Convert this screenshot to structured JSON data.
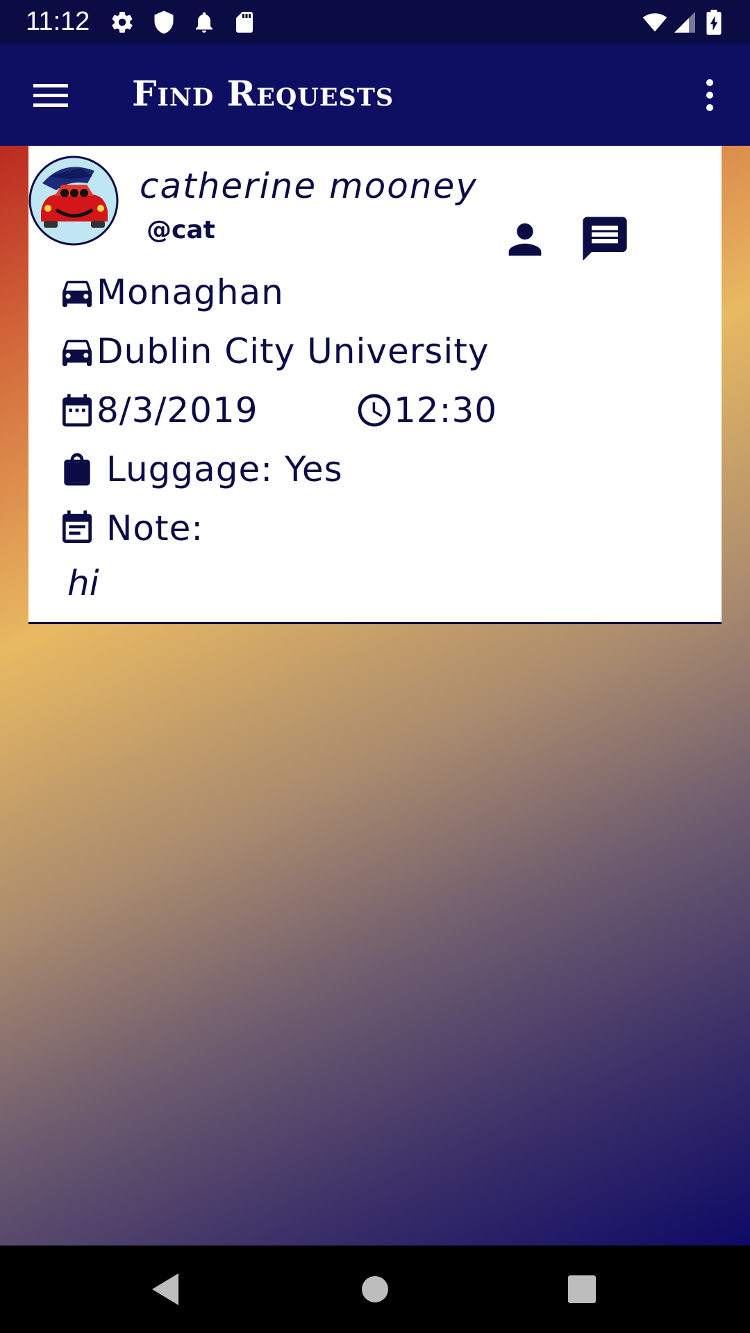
{
  "status_bar": {
    "time": "11:12",
    "icons": [
      "settings-icon",
      "shield-icon",
      "bell-icon",
      "sd-card-icon",
      "wifi-icon",
      "signal-icon",
      "battery-charging-icon"
    ]
  },
  "app_bar": {
    "title": "Find Requests",
    "menu_icon": "hamburger-menu-icon",
    "overflow_icon": "more-vert-icon"
  },
  "request_card": {
    "user_name": "catherine mooney",
    "user_handle": "@cat",
    "from": "Monaghan",
    "to": "Dublin City University",
    "date": "8/3/2019",
    "time": "12:30",
    "luggage": "Luggage: Yes",
    "note_label": "Note:",
    "note": "hi"
  },
  "colors": {
    "primary_dark": "#0c0c45",
    "app_bar": "#0e0f63",
    "card": "#ffffff",
    "text": "#0c0c45"
  },
  "nav_bar": {
    "icons": [
      "back-icon",
      "home-icon",
      "recents-icon"
    ]
  }
}
